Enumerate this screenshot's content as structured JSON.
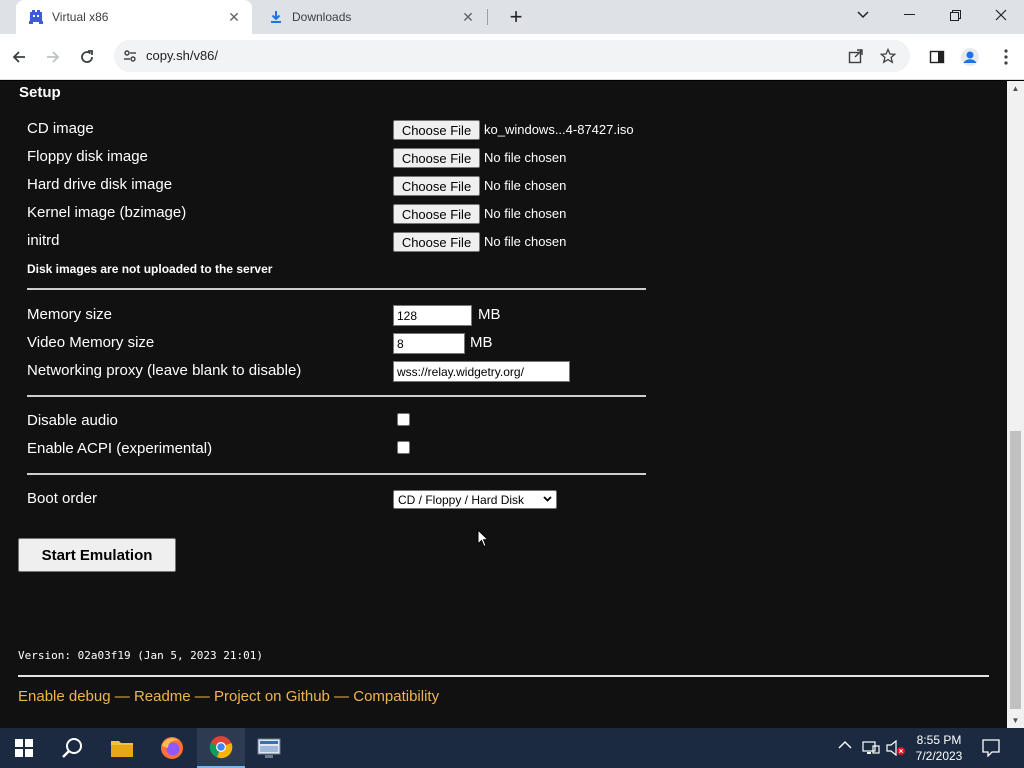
{
  "browser": {
    "tabs": [
      {
        "title": "Virtual x86",
        "active": true
      },
      {
        "title": "Downloads",
        "active": false
      }
    ],
    "url": "copy.sh/v86/"
  },
  "setup": {
    "title": "Setup",
    "files": [
      {
        "label": "CD image",
        "button": "Choose File",
        "value": "ko_windows...4-87427.iso"
      },
      {
        "label": "Floppy disk image",
        "button": "Choose File",
        "value": "No file chosen"
      },
      {
        "label": "Hard drive disk image",
        "button": "Choose File",
        "value": "No file chosen"
      },
      {
        "label": "Kernel image (bzimage)",
        "button": "Choose File",
        "value": "No file chosen"
      },
      {
        "label": "initrd",
        "button": "Choose File",
        "value": "No file chosen"
      }
    ],
    "note": "Disk images are not uploaded to the server",
    "memory": {
      "label": "Memory size",
      "value": "128",
      "unit": "MB"
    },
    "video_memory": {
      "label": "Video Memory size",
      "value": "8",
      "unit": "MB"
    },
    "proxy": {
      "label": "Networking proxy (leave blank to disable)",
      "value": "wss://relay.widgetry.org/"
    },
    "disable_audio": {
      "label": "Disable audio",
      "checked": false
    },
    "acpi": {
      "label": "Enable ACPI (experimental)",
      "checked": false
    },
    "boot_order": {
      "label": "Boot order",
      "value": "CD / Floppy / Hard Disk"
    },
    "start_button": "Start Emulation"
  },
  "footer": {
    "version": "Version: 02a03f19 (Jan 5, 2023 21:01)",
    "links": [
      "Enable debug",
      "Readme",
      "Project on Github",
      "Compatibility"
    ],
    "separator": " — "
  },
  "taskbar": {
    "time": "8:55 PM",
    "date": "7/2/2023"
  },
  "colors": {
    "link": "#f0b44c",
    "page_bg": "#111111",
    "taskbar_bg": "#1b2a40"
  }
}
